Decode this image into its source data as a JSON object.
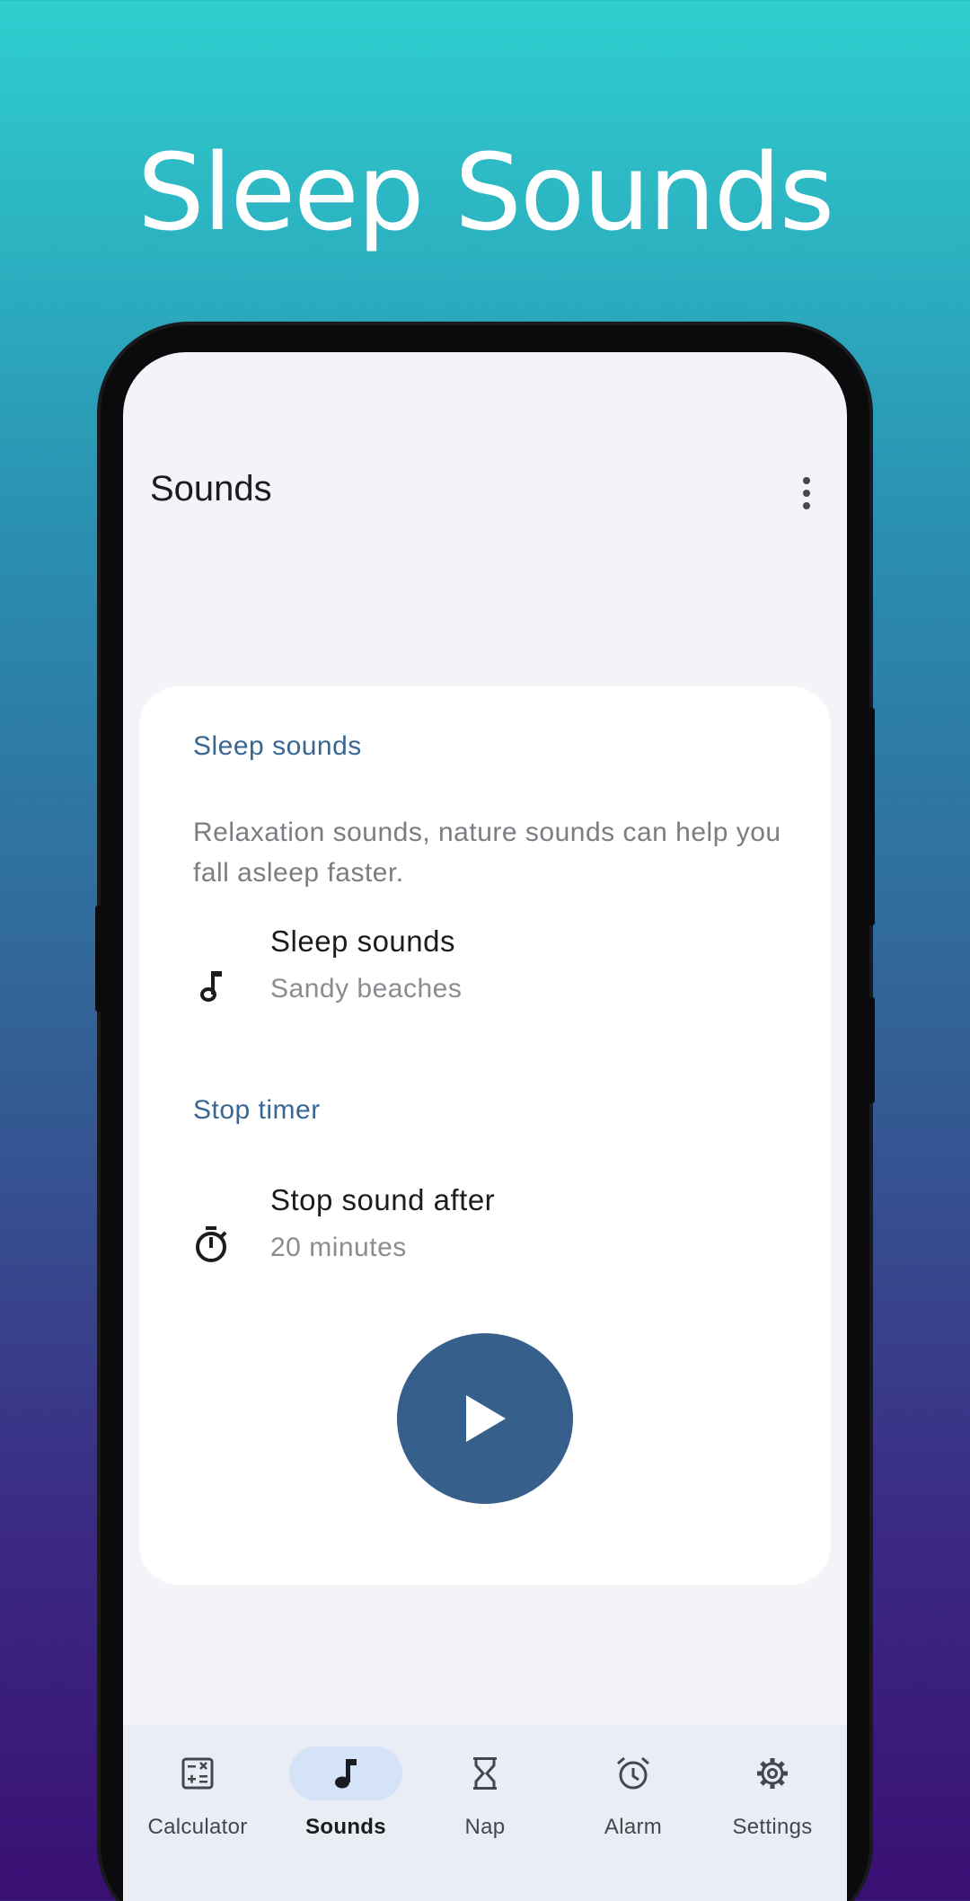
{
  "promo": {
    "title": "Sleep Sounds"
  },
  "app_bar": {
    "title": "Sounds",
    "menu_icon": "more-vert-icon"
  },
  "card": {
    "section_sleep": {
      "header": "Sleep sounds"
    },
    "description": "Relaxation sounds, nature sounds can help you fall asleep faster.",
    "sleep_sound_pref": {
      "icon": "music-note-icon",
      "title": "Sleep sounds",
      "value": "Sandy beaches"
    },
    "section_timer": {
      "header": "Stop timer"
    },
    "stop_timer_pref": {
      "icon": "timer-icon",
      "title": "Stop sound after",
      "value": "20 minutes"
    },
    "play_button": {
      "icon": "play-icon"
    }
  },
  "nav": {
    "selected": "Sounds",
    "items": [
      {
        "label": "Calculator",
        "icon": "calculator-icon"
      },
      {
        "label": "Sounds",
        "icon": "music-note-icon"
      },
      {
        "label": "Nap",
        "icon": "hourglass-icon"
      },
      {
        "label": "Alarm",
        "icon": "alarm-icon"
      },
      {
        "label": "Settings",
        "icon": "gear-icon"
      }
    ]
  },
  "colors": {
    "accent": "#365f8c",
    "section_header": "#3a6694",
    "nav_active_pill": "#d4e3f7",
    "gradient_top": "#2ecfcf",
    "gradient_bottom": "#3a0f74"
  }
}
